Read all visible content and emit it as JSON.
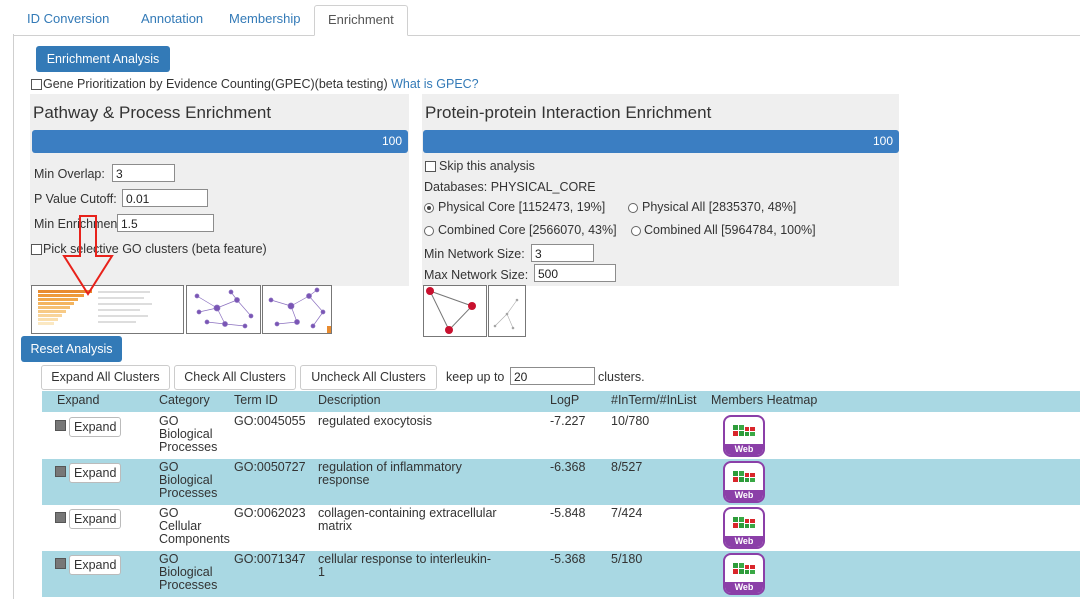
{
  "tabs": [
    {
      "label": "ID Conversion",
      "active": false
    },
    {
      "label": "Annotation",
      "active": false
    },
    {
      "label": "Membership",
      "active": false
    },
    {
      "label": "Enrichment",
      "active": true
    }
  ],
  "buttons": {
    "enrichment_analysis": "Enrichment Analysis",
    "reset_analysis": "Reset Analysis",
    "expand_all": "Expand All Clusters",
    "check_all": "Check All Clusters",
    "uncheck_all": "Uncheck All Clusters"
  },
  "gpec": {
    "label": "Gene Prioritization by Evidence Counting(GPEC)(beta testing)",
    "link": "What is GPEC?",
    "checked": false
  },
  "pathway": {
    "title": "Pathway & Process Enrichment",
    "progress": 100,
    "progress_label": "100",
    "min_overlap_label": "Min Overlap:",
    "min_overlap": "3",
    "p_cutoff_label": "P Value Cutoff:",
    "p_cutoff": "0.01",
    "min_enrichment_label": "Min Enrichment:",
    "min_enrichment": "1.5",
    "pick_go_label": "Pick selective GO clusters (beta feature)",
    "pick_go_checked": false
  },
  "ppi": {
    "title": "Protein-protein Interaction Enrichment",
    "progress": 100,
    "progress_label": "100",
    "skip_label": "Skip this analysis",
    "skip_checked": false,
    "databases_label": "Databases: PHYSICAL_CORE",
    "options": [
      {
        "label": "Physical Core [1152473, 19%]",
        "selected": true
      },
      {
        "label": "Physical All [2835370, 48%]",
        "selected": false
      },
      {
        "label": "Combined Core [2566070, 43%]",
        "selected": false
      },
      {
        "label": "Combined All [5964784, 100%]",
        "selected": false
      }
    ],
    "min_network_label": "Min Network Size:",
    "min_network": "3",
    "max_network_label": "Max Network Size:",
    "max_network": "500"
  },
  "cluster_controls": {
    "keep_label": "keep up to",
    "keep_value": "20",
    "clusters_label": "clusters."
  },
  "table": {
    "headers": [
      "Expand",
      "Category",
      "Term ID",
      "Description",
      "LogP",
      "#InTerm/#InList",
      "Members Heatmap"
    ],
    "rows": [
      {
        "expand": "Expand",
        "checked": true,
        "category": [
          "GO",
          "Biological",
          "Processes"
        ],
        "term_id": "GO:0045055",
        "description": [
          "regulated exocytosis"
        ],
        "logp": "-7.227",
        "ratio": "10/780",
        "heatmap_label": "Web"
      },
      {
        "expand": "Expand",
        "checked": true,
        "category": [
          "GO",
          "Biological",
          "Processes"
        ],
        "term_id": "GO:0050727",
        "description": [
          "regulation of inflammatory",
          "response"
        ],
        "logp": "-6.368",
        "ratio": "8/527",
        "heatmap_label": "Web"
      },
      {
        "expand": "Expand",
        "checked": true,
        "category": [
          "GO",
          "Cellular",
          "Components"
        ],
        "term_id": "GO:0062023",
        "description": [
          "collagen-containing extracellular",
          "matrix"
        ],
        "logp": "-5.848",
        "ratio": "7/424",
        "heatmap_label": "Web"
      },
      {
        "expand": "Expand",
        "checked": true,
        "category": [
          "GO",
          "Biological",
          "Processes"
        ],
        "term_id": "GO:0071347",
        "description": [
          "cellular response to interleukin-",
          "1"
        ],
        "logp": "-5.368",
        "ratio": "5/180",
        "heatmap_label": "Web"
      }
    ]
  },
  "colors": {
    "accent": "#337ab7",
    "row_highlight": "#a9d8e3",
    "heatmap_border": "#8b3fa8",
    "arrow": "#e8221b"
  }
}
